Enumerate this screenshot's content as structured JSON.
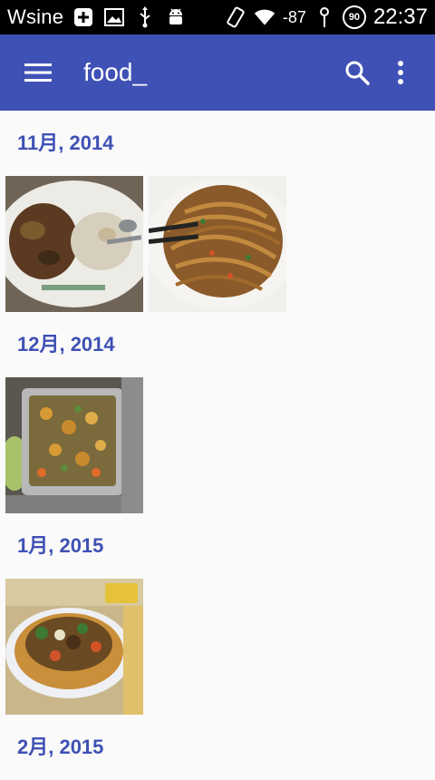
{
  "status_bar": {
    "carrier": "Wsine",
    "signal": "-87",
    "battery": "90",
    "time": "22:37",
    "icons": [
      "plus-box-icon",
      "image-icon",
      "usb-icon",
      "android-icon",
      "rotate-icon",
      "wifi-icon"
    ]
  },
  "app_bar": {
    "search_value": "food_",
    "icons": [
      "hamburger-menu-icon",
      "search-icon",
      "overflow-menu-icon"
    ],
    "color": "#3f51b5"
  },
  "groups": [
    {
      "month": "11月, 2014",
      "photo_count": 2
    },
    {
      "month": "12月, 2014",
      "photo_count": 1
    },
    {
      "month": "1月, 2015",
      "photo_count": 1
    },
    {
      "month": "2月, 2015",
      "photo_count": 0
    }
  ],
  "colors": {
    "accent": "#3f51b5",
    "background": "#fafafa"
  }
}
